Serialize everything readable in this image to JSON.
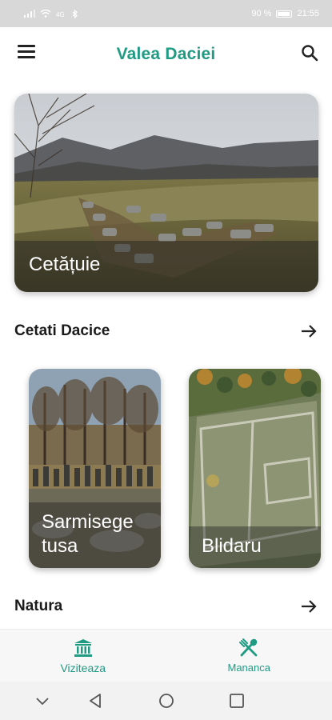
{
  "status_bar": {
    "left_icons": [
      "signal-icon",
      "wifi-icon",
      "data-icon",
      "bluetooth-icon"
    ],
    "battery": "90 %",
    "time": "21:55"
  },
  "app_bar": {
    "title": "Valea Daciei",
    "menu_icon": "menu-icon",
    "search_icon": "search-icon"
  },
  "hero": {
    "label": "Cetățuie"
  },
  "sections": [
    {
      "title": "Cetati Dacice",
      "cards": [
        {
          "label": "Sarmisege tusa"
        },
        {
          "label": "Blidaru"
        }
      ]
    },
    {
      "title": "Natura",
      "cards": []
    }
  ],
  "bottom_nav": {
    "items": [
      {
        "label": "Viziteaza",
        "icon": "museum-icon",
        "active": true
      },
      {
        "label": "Mananca",
        "icon": "fork-spoon-icon",
        "active": false
      }
    ]
  },
  "colors": {
    "accent": "#1f9a83",
    "status_bar": "#d8d8d8",
    "nav_bg": "#f7f7f7"
  }
}
